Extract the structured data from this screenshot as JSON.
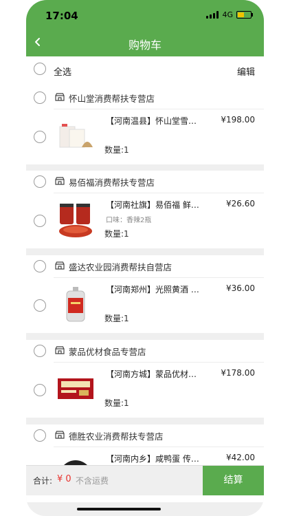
{
  "status_bar": {
    "time": "17:04",
    "network": "4G"
  },
  "header": {
    "title": "购物车"
  },
  "select_bar": {
    "select_all_label": "全选",
    "edit_label": "编辑"
  },
  "stores": [
    {
      "name": "怀山堂消费帮扶专营店",
      "product": "【河南温县】怀山堂雪…",
      "price": "¥198.00",
      "variant": "",
      "quantity": "数量:1"
    },
    {
      "name": "易佰福消费帮扶专营店",
      "product": "【河南社旗】易佰福 鲜…",
      "price": "¥26.60",
      "variant": "口味：香辣2瓶",
      "quantity": "数量:1"
    },
    {
      "name": "盛达农业园消费帮扶自营店",
      "product": "【河南郑州】光照黄酒 …",
      "price": "¥36.00",
      "variant": "",
      "quantity": "数量:1"
    },
    {
      "name": "蒙品优材食品专营店",
      "product": "【河南方城】蒙品优材…",
      "price": "¥178.00",
      "variant": "",
      "quantity": "数量:1"
    },
    {
      "name": "德胜农业消费帮扶专营店",
      "product": "【河南内乡】咸鸭蛋 传…",
      "price": "¥42.00",
      "variant": "",
      "quantity": ""
    }
  ],
  "footer": {
    "total_label": "合计:",
    "total_amount": "¥ 0",
    "shipping_note": "不含运费",
    "checkout_label": "结算"
  },
  "colors": {
    "accent": "#5aab4e",
    "price_red": "#e8312d",
    "background": "#efefef"
  }
}
